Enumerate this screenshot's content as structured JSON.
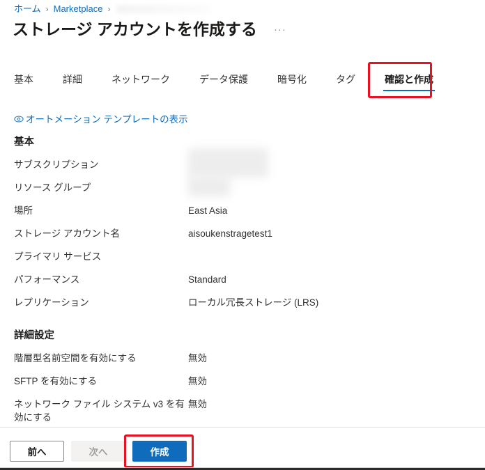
{
  "breadcrumb": {
    "items": [
      {
        "label": "ホーム",
        "link": true
      },
      {
        "label": "Marketplace",
        "link": true
      }
    ],
    "separator": "›",
    "has_redacted_trailing": true
  },
  "header": {
    "title": "ストレージ アカウントを作成する",
    "ellipsis_label": "···"
  },
  "tabs": [
    {
      "label": "基本",
      "active": false
    },
    {
      "label": "詳細",
      "active": false
    },
    {
      "label": "ネットワーク",
      "active": false
    },
    {
      "label": "データ保護",
      "active": false
    },
    {
      "label": "暗号化",
      "active": false
    },
    {
      "label": "タグ",
      "active": false
    },
    {
      "label": "確認と作成",
      "active": true,
      "annotated": true
    }
  ],
  "automation_link": {
    "label": "オートメーション テンプレートの表示",
    "icon": "eye-icon"
  },
  "sections": [
    {
      "heading": "基本",
      "rows": [
        {
          "label": "サブスクリプション",
          "value": "",
          "redacted": true
        },
        {
          "label": "リソース グループ",
          "value": "",
          "redacted": true
        },
        {
          "label": "場所",
          "value": "East Asia",
          "redacted": false
        },
        {
          "label": "ストレージ アカウント名",
          "value": "aisoukenstragetest1",
          "redacted": false
        },
        {
          "label": "プライマリ サービス",
          "value": "",
          "redacted": false
        },
        {
          "label": "パフォーマンス",
          "value": "Standard",
          "redacted": false
        },
        {
          "label": "レプリケーション",
          "value": "ローカル冗長ストレージ (LRS)",
          "redacted": false
        }
      ]
    },
    {
      "heading": "詳細設定",
      "rows": [
        {
          "label": "階層型名前空間を有効にする",
          "value": "無効",
          "redacted": false
        },
        {
          "label": "SFTP を有効にする",
          "value": "無効",
          "redacted": false
        },
        {
          "label": "ネットワーク ファイル システム v3 を有効にする",
          "value": "無効",
          "redacted": false
        }
      ]
    }
  ],
  "footer": {
    "previous_label": "前へ",
    "next_label": "次へ",
    "create_label": "作成"
  },
  "colors": {
    "accent_blue": "#0f6cbd",
    "annotation_red": "#e81123",
    "text_primary": "#1b1a19",
    "text_secondary": "#323130",
    "disabled_text": "#a19f9d",
    "divider": "#e1dfdd"
  }
}
